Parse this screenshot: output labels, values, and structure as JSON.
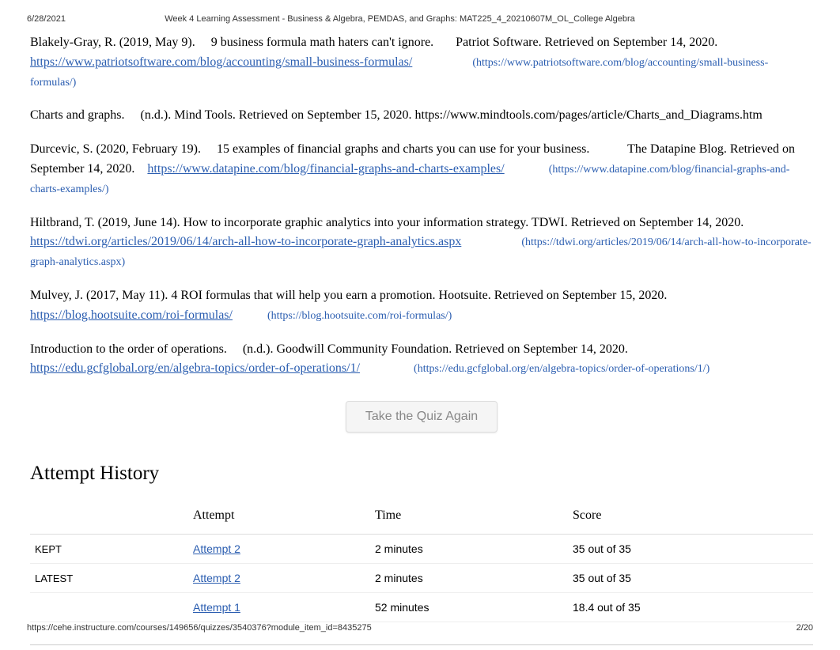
{
  "header": {
    "date": "6/28/2021",
    "title": "Week 4 Learning Assessment - Business & Algebra, PEMDAS, and Graphs: MAT225_4_20210607M_OL_College Algebra"
  },
  "references": [
    {
      "pre": "Blakely-Gray, R. (2019, May 9).     9 business formula math haters can't ignore.       Patriot Software. Retrieved on September 14, 2020. ",
      "link": "https://www.patriotsoftware.com/blog/accounting/small-business-formulas/",
      "paren": "(https://www.patriotsoftware.com/blog/accounting/small-business-formulas/)"
    },
    {
      "pre": "Charts and graphs.     (n.d.). Mind Tools. Retrieved on September 15, 2020. https://www.mindtools.com/pages/article/Charts_and_Diagrams.htm",
      "link": "",
      "paren": ""
    },
    {
      "pre": "Durcevic, S. (2020, February 19).     15 examples of financial graphs and charts you can use for your business.            The Datapine Blog. Retrieved on September 14, 2020.    ",
      "link": "https://www.datapine.com/blog/financial-graphs-and-charts-examples/",
      "paren": "(https://www.datapine.com/blog/financial-graphs-and-charts-examples/)"
    },
    {
      "pre": "Hiltbrand, T. (2019, June 14). How to incorporate graphic analytics into your information strategy. TDWI. Retrieved on September 14, 2020. ",
      "link": "https://tdwi.org/articles/2019/06/14/arch-all-how-to-incorporate-graph-analytics.aspx",
      "paren": "(https://tdwi.org/articles/2019/06/14/arch-all-how-to-incorporate-graph-analytics.aspx)"
    },
    {
      "pre": "Mulvey, J. (2017, May 11). 4 ROI formulas that will help you earn a promotion. Hootsuite. Retrieved on September 15, 2020. ",
      "link": "https://blog.hootsuite.com/roi-formulas/",
      "paren": "(https://blog.hootsuite.com/roi-formulas/)"
    },
    {
      "pre": "Introduction to the order of operations.     (n.d.). Goodwill Community Foundation. Retrieved on September 14, 2020. ",
      "link": "https://edu.gcfglobal.org/en/algebra-topics/order-of-operations/1/",
      "paren": "(https://edu.gcfglobal.org/en/algebra-topics/order-of-operations/1/)"
    }
  ],
  "quiz_button": "Take the Quiz Again",
  "attempt_history": {
    "title": "Attempt History",
    "headers": {
      "blank": "",
      "attempt": "Attempt",
      "time": "Time",
      "score": "Score"
    },
    "rows": [
      {
        "tag": "KEPT",
        "attempt": "Attempt 2",
        "time": "2 minutes",
        "score": "35 out of 35"
      },
      {
        "tag": "LATEST",
        "attempt": "Attempt 2",
        "time": "2 minutes",
        "score": "35 out of 35"
      },
      {
        "tag": "",
        "attempt": "Attempt 1",
        "time": "52 minutes",
        "score": "18.4 out of 35"
      }
    ]
  },
  "footer": {
    "url": "https://cehe.instructure.com/courses/149656/quizzes/3540376?module_item_id=8435275",
    "page": "2/20"
  }
}
